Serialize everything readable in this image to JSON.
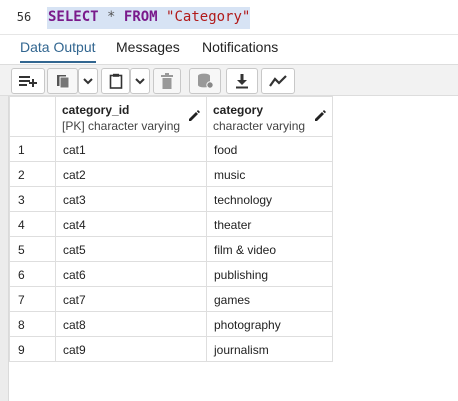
{
  "editor": {
    "line_number": "56",
    "kw_select": "SELECT",
    "op_star": "*",
    "kw_from": "FROM",
    "table_string": "\"Category\""
  },
  "tabs": [
    {
      "label": "Data Output",
      "active": true
    },
    {
      "label": "Messages",
      "active": false
    },
    {
      "label": "Notifications",
      "active": false
    }
  ],
  "toolbar": {
    "buttons": [
      {
        "icon": "add-row-icon"
      },
      {
        "icon": "copy-icon"
      },
      {
        "icon": "chevron-down-icon"
      },
      {
        "icon": "paste-icon"
      },
      {
        "icon": "chevron-down-icon"
      },
      {
        "icon": "delete-icon"
      },
      {
        "icon": "save-data-icon"
      },
      {
        "icon": "download-icon"
      },
      {
        "icon": "graph-icon"
      }
    ]
  },
  "grid": {
    "columns": [
      {
        "name": "category_id",
        "type": "[PK] character varying"
      },
      {
        "name": "category",
        "type": "character varying"
      }
    ],
    "rows": [
      {
        "n": "1",
        "id": "cat1",
        "name": "food"
      },
      {
        "n": "2",
        "id": "cat2",
        "name": "music"
      },
      {
        "n": "3",
        "id": "cat3",
        "name": "technology"
      },
      {
        "n": "4",
        "id": "cat4",
        "name": "theater"
      },
      {
        "n": "5",
        "id": "cat5",
        "name": "film & video"
      },
      {
        "n": "6",
        "id": "cat6",
        "name": "publishing"
      },
      {
        "n": "7",
        "id": "cat7",
        "name": "games"
      },
      {
        "n": "8",
        "id": "cat8",
        "name": "photography"
      },
      {
        "n": "9",
        "id": "cat9",
        "name": "journalism"
      }
    ]
  },
  "colors": {
    "accent": "#326690",
    "keyword": "#7a1a8b",
    "string": "#b11a1a",
    "selection": "#d7e3f4"
  }
}
